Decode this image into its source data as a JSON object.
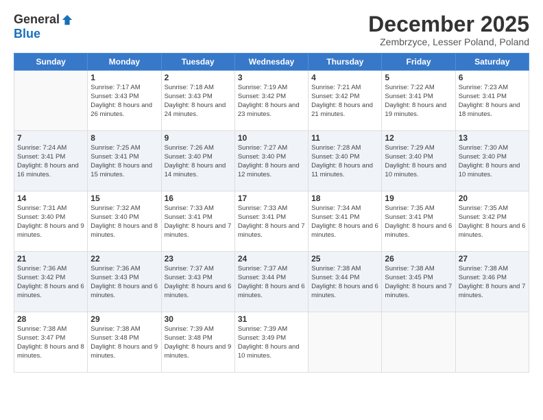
{
  "logo": {
    "general": "General",
    "blue": "Blue"
  },
  "header": {
    "month": "December 2025",
    "location": "Zembrzyce, Lesser Poland, Poland"
  },
  "weekdays": [
    "Sunday",
    "Monday",
    "Tuesday",
    "Wednesday",
    "Thursday",
    "Friday",
    "Saturday"
  ],
  "weeks": [
    [
      {
        "day": "",
        "sunrise": "",
        "sunset": "",
        "daylight": ""
      },
      {
        "day": "1",
        "sunrise": "Sunrise: 7:17 AM",
        "sunset": "Sunset: 3:43 PM",
        "daylight": "Daylight: 8 hours and 26 minutes."
      },
      {
        "day": "2",
        "sunrise": "Sunrise: 7:18 AM",
        "sunset": "Sunset: 3:43 PM",
        "daylight": "Daylight: 8 hours and 24 minutes."
      },
      {
        "day": "3",
        "sunrise": "Sunrise: 7:19 AM",
        "sunset": "Sunset: 3:42 PM",
        "daylight": "Daylight: 8 hours and 23 minutes."
      },
      {
        "day": "4",
        "sunrise": "Sunrise: 7:21 AM",
        "sunset": "Sunset: 3:42 PM",
        "daylight": "Daylight: 8 hours and 21 minutes."
      },
      {
        "day": "5",
        "sunrise": "Sunrise: 7:22 AM",
        "sunset": "Sunset: 3:41 PM",
        "daylight": "Daylight: 8 hours and 19 minutes."
      },
      {
        "day": "6",
        "sunrise": "Sunrise: 7:23 AM",
        "sunset": "Sunset: 3:41 PM",
        "daylight": "Daylight: 8 hours and 18 minutes."
      }
    ],
    [
      {
        "day": "7",
        "sunrise": "Sunrise: 7:24 AM",
        "sunset": "Sunset: 3:41 PM",
        "daylight": "Daylight: 8 hours and 16 minutes."
      },
      {
        "day": "8",
        "sunrise": "Sunrise: 7:25 AM",
        "sunset": "Sunset: 3:41 PM",
        "daylight": "Daylight: 8 hours and 15 minutes."
      },
      {
        "day": "9",
        "sunrise": "Sunrise: 7:26 AM",
        "sunset": "Sunset: 3:40 PM",
        "daylight": "Daylight: 8 hours and 14 minutes."
      },
      {
        "day": "10",
        "sunrise": "Sunrise: 7:27 AM",
        "sunset": "Sunset: 3:40 PM",
        "daylight": "Daylight: 8 hours and 12 minutes."
      },
      {
        "day": "11",
        "sunrise": "Sunrise: 7:28 AM",
        "sunset": "Sunset: 3:40 PM",
        "daylight": "Daylight: 8 hours and 11 minutes."
      },
      {
        "day": "12",
        "sunrise": "Sunrise: 7:29 AM",
        "sunset": "Sunset: 3:40 PM",
        "daylight": "Daylight: 8 hours and 10 minutes."
      },
      {
        "day": "13",
        "sunrise": "Sunrise: 7:30 AM",
        "sunset": "Sunset: 3:40 PM",
        "daylight": "Daylight: 8 hours and 10 minutes."
      }
    ],
    [
      {
        "day": "14",
        "sunrise": "Sunrise: 7:31 AM",
        "sunset": "Sunset: 3:40 PM",
        "daylight": "Daylight: 8 hours and 9 minutes."
      },
      {
        "day": "15",
        "sunrise": "Sunrise: 7:32 AM",
        "sunset": "Sunset: 3:40 PM",
        "daylight": "Daylight: 8 hours and 8 minutes."
      },
      {
        "day": "16",
        "sunrise": "Sunrise: 7:33 AM",
        "sunset": "Sunset: 3:41 PM",
        "daylight": "Daylight: 8 hours and 7 minutes."
      },
      {
        "day": "17",
        "sunrise": "Sunrise: 7:33 AM",
        "sunset": "Sunset: 3:41 PM",
        "daylight": "Daylight: 8 hours and 7 minutes."
      },
      {
        "day": "18",
        "sunrise": "Sunrise: 7:34 AM",
        "sunset": "Sunset: 3:41 PM",
        "daylight": "Daylight: 8 hours and 6 minutes."
      },
      {
        "day": "19",
        "sunrise": "Sunrise: 7:35 AM",
        "sunset": "Sunset: 3:41 PM",
        "daylight": "Daylight: 8 hours and 6 minutes."
      },
      {
        "day": "20",
        "sunrise": "Sunrise: 7:35 AM",
        "sunset": "Sunset: 3:42 PM",
        "daylight": "Daylight: 8 hours and 6 minutes."
      }
    ],
    [
      {
        "day": "21",
        "sunrise": "Sunrise: 7:36 AM",
        "sunset": "Sunset: 3:42 PM",
        "daylight": "Daylight: 8 hours and 6 minutes."
      },
      {
        "day": "22",
        "sunrise": "Sunrise: 7:36 AM",
        "sunset": "Sunset: 3:43 PM",
        "daylight": "Daylight: 8 hours and 6 minutes."
      },
      {
        "day": "23",
        "sunrise": "Sunrise: 7:37 AM",
        "sunset": "Sunset: 3:43 PM",
        "daylight": "Daylight: 8 hours and 6 minutes."
      },
      {
        "day": "24",
        "sunrise": "Sunrise: 7:37 AM",
        "sunset": "Sunset: 3:44 PM",
        "daylight": "Daylight: 8 hours and 6 minutes."
      },
      {
        "day": "25",
        "sunrise": "Sunrise: 7:38 AM",
        "sunset": "Sunset: 3:44 PM",
        "daylight": "Daylight: 8 hours and 6 minutes."
      },
      {
        "day": "26",
        "sunrise": "Sunrise: 7:38 AM",
        "sunset": "Sunset: 3:45 PM",
        "daylight": "Daylight: 8 hours and 7 minutes."
      },
      {
        "day": "27",
        "sunrise": "Sunrise: 7:38 AM",
        "sunset": "Sunset: 3:46 PM",
        "daylight": "Daylight: 8 hours and 7 minutes."
      }
    ],
    [
      {
        "day": "28",
        "sunrise": "Sunrise: 7:38 AM",
        "sunset": "Sunset: 3:47 PM",
        "daylight": "Daylight: 8 hours and 8 minutes."
      },
      {
        "day": "29",
        "sunrise": "Sunrise: 7:38 AM",
        "sunset": "Sunset: 3:48 PM",
        "daylight": "Daylight: 8 hours and 9 minutes."
      },
      {
        "day": "30",
        "sunrise": "Sunrise: 7:39 AM",
        "sunset": "Sunset: 3:48 PM",
        "daylight": "Daylight: 8 hours and 9 minutes."
      },
      {
        "day": "31",
        "sunrise": "Sunrise: 7:39 AM",
        "sunset": "Sunset: 3:49 PM",
        "daylight": "Daylight: 8 hours and 10 minutes."
      },
      {
        "day": "",
        "sunrise": "",
        "sunset": "",
        "daylight": ""
      },
      {
        "day": "",
        "sunrise": "",
        "sunset": "",
        "daylight": ""
      },
      {
        "day": "",
        "sunrise": "",
        "sunset": "",
        "daylight": ""
      }
    ]
  ]
}
